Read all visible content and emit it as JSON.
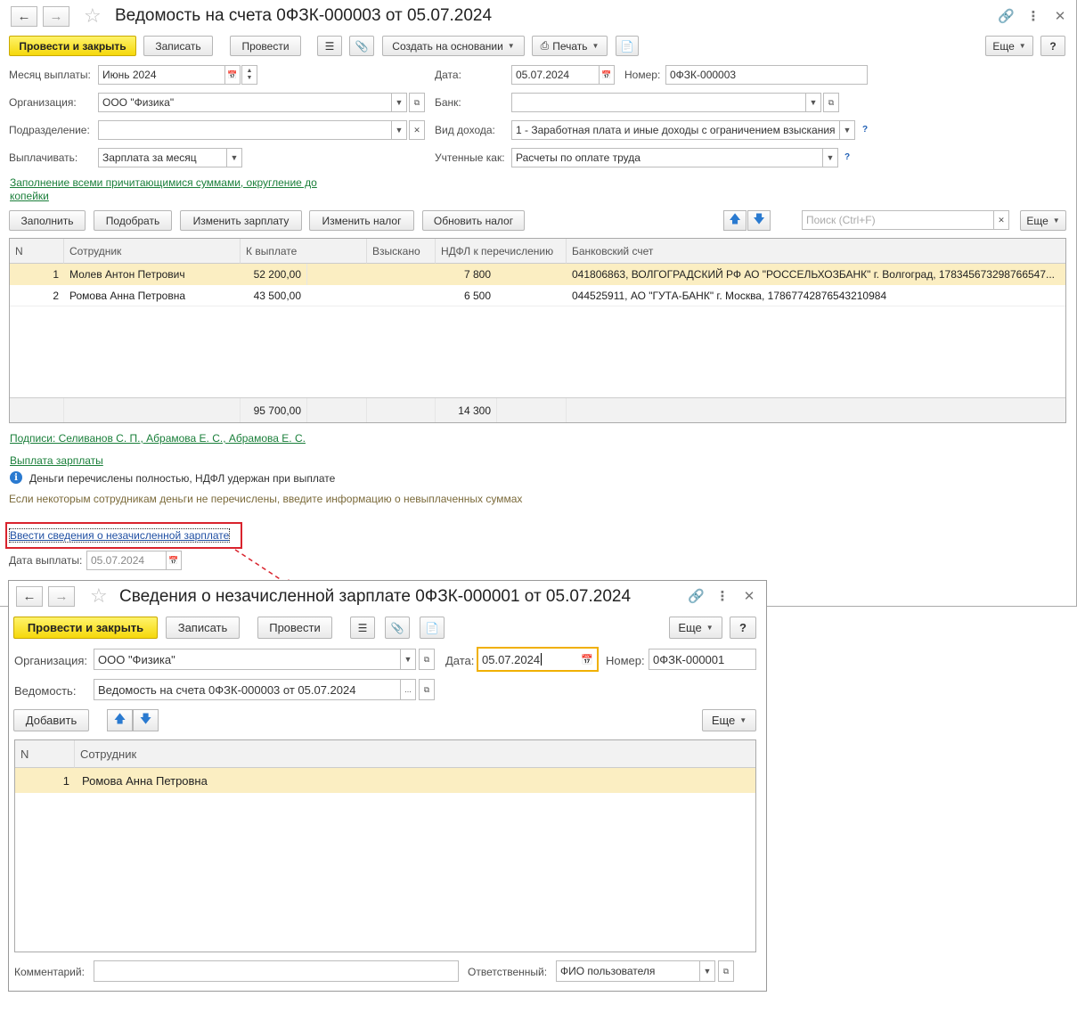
{
  "main": {
    "title": "Ведомость на счета 0ФЗК-000003 от 05.07.2024",
    "toolbar": {
      "post_close": "Провести и закрыть",
      "save": "Записать",
      "post": "Провести",
      "create_based": "Создать на основании",
      "print": "Печать",
      "more": "Еще",
      "help": "?"
    },
    "fields": {
      "month_label": "Месяц выплаты:",
      "month_value": "Июнь 2024",
      "date_label": "Дата:",
      "date_value": "05.07.2024",
      "number_label": "Номер:",
      "number_value": "0ФЗК-000003",
      "org_label": "Организация:",
      "org_value": "ООО \"Физика\"",
      "bank_label": "Банк:",
      "bank_value": "",
      "dept_label": "Подразделение:",
      "dept_value": "",
      "income_label": "Вид дохода:",
      "income_value": "1 - Заработная плата и иные доходы с ограничением взыскания",
      "pay_label": "Выплачивать:",
      "pay_value": "Зарплата за месяц",
      "accounted_label": "Учтенные как:",
      "accounted_value": "Расчеты по оплате труда",
      "help_mark": "?"
    },
    "fill_link_1": "Заполнение всеми причитающимися суммами, округление до",
    "fill_link_2": "копейки",
    "table_toolbar": {
      "fill": "Заполнить",
      "pick": "Подобрать",
      "change_salary": "Изменить зарплату",
      "change_tax": "Изменить налог",
      "refresh_tax": "Обновить налог",
      "search_placeholder": "Поиск (Ctrl+F)",
      "more": "Еще"
    },
    "table": {
      "headers": [
        "N",
        "Сотрудник",
        "К выплате",
        "Взыскано",
        "НДФЛ к перечислению",
        "Банковский счет"
      ],
      "rows": [
        {
          "n": "1",
          "employee": "Молев Антон Петрович",
          "pay": "52 200,00",
          "recovered": "",
          "ndfl": "7 800",
          "account": "041806863, ВОЛГОГРАДСКИЙ РФ АО \"РОССЕЛЬХОЗБАНК\" г. Волгоград, 178345673298766547..."
        },
        {
          "n": "2",
          "employee": "Ромова Анна Петровна",
          "pay": "43 500,00",
          "recovered": "",
          "ndfl": "6 500",
          "account": "044525911, АО \"ГУТА-БАНК\" г. Москва, 17867742876543210984"
        }
      ],
      "total_pay": "95 700,00",
      "total_ndfl": "14 300"
    },
    "signatures_link": "Подписи: Селиванов С. П., Абрамова Е. С., Абрамова Е. С.",
    "payout_link": "Выплата зарплаты",
    "info_text": "Деньги перечислены  полностью, НДФЛ удержан при выплате",
    "hint_text": "Если некоторым сотрудникам деньги не перечислены, введите информацию о невыплаченных суммах",
    "enter_link": "Ввести сведения о незачисленной зарплате",
    "payout_date_label": "Дата выплаты:",
    "payout_date_value": "05.07.2024"
  },
  "dialog": {
    "title": "Сведения о незачисленной зарплате 0ФЗК-000001 от 05.07.2024",
    "toolbar": {
      "post_close": "Провести и закрыть",
      "save": "Записать",
      "post": "Провести",
      "more": "Еще",
      "help": "?"
    },
    "fields": {
      "org_label": "Организация:",
      "org_value": "ООО \"Физика\"",
      "date_label": "Дата:",
      "date_value": "05.07.2024",
      "number_label": "Номер:",
      "number_value": "0ФЗК-000001",
      "statement_label": "Ведомость:",
      "statement_value": "Ведомость на счета 0ФЗК-000003 от 05.07.2024"
    },
    "add": "Добавить",
    "more": "Еще",
    "table": {
      "headers": [
        "N",
        "Сотрудник"
      ],
      "rows": [
        {
          "n": "1",
          "employee": "Ромова Анна Петровна"
        }
      ]
    },
    "comment_label": "Комментарий:",
    "comment_value": "",
    "responsible_label": "Ответственный:",
    "responsible_value": "ФИО пользователя"
  },
  "colors": {
    "highlight_box": "#d9232d",
    "arrow": "#d9232d",
    "primary_button": "#f5d80b",
    "selected_row": "#fbeec2"
  }
}
